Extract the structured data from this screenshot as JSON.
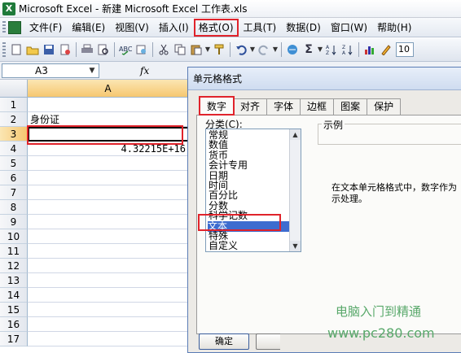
{
  "window": {
    "title": "Microsoft Excel - 新建 Microsoft Excel 工作表.xls"
  },
  "menubar": {
    "items": [
      {
        "label": "文件(F)"
      },
      {
        "label": "编辑(E)"
      },
      {
        "label": "视图(V)"
      },
      {
        "label": "插入(I)"
      },
      {
        "label": "格式(O)",
        "highlighted": true
      },
      {
        "label": "工具(T)"
      },
      {
        "label": "数据(D)"
      },
      {
        "label": "窗口(W)"
      },
      {
        "label": "帮助(H)"
      }
    ]
  },
  "toolbar": {
    "zoom_value": "10"
  },
  "formula_bar": {
    "name_box": "A3",
    "fx_label": "fx"
  },
  "sheet": {
    "column_header": "A",
    "rows": [
      {
        "num": "1",
        "value": ""
      },
      {
        "num": "2",
        "value": "身份证"
      },
      {
        "num": "3",
        "value": "",
        "selected": true
      },
      {
        "num": "4",
        "value": "4.32215E+16"
      },
      {
        "num": "5",
        "value": ""
      },
      {
        "num": "6",
        "value": ""
      },
      {
        "num": "7",
        "value": ""
      },
      {
        "num": "8",
        "value": ""
      },
      {
        "num": "9",
        "value": ""
      },
      {
        "num": "10",
        "value": ""
      },
      {
        "num": "11",
        "value": ""
      },
      {
        "num": "12",
        "value": ""
      },
      {
        "num": "13",
        "value": ""
      },
      {
        "num": "14",
        "value": ""
      },
      {
        "num": "15",
        "value": ""
      },
      {
        "num": "16",
        "value": ""
      },
      {
        "num": "17",
        "value": ""
      }
    ]
  },
  "dialog": {
    "title": "单元格格式",
    "tabs": [
      {
        "label": "数字",
        "active": true
      },
      {
        "label": "对齐"
      },
      {
        "label": "字体"
      },
      {
        "label": "边框"
      },
      {
        "label": "图案"
      },
      {
        "label": "保护"
      }
    ],
    "category_label": "分类(C):",
    "categories": [
      "常规",
      "数值",
      "货币",
      "会计专用",
      "日期",
      "时间",
      "百分比",
      "分数",
      "科学记数",
      "文本",
      "特殊",
      "自定义"
    ],
    "selected_category": "文本",
    "sample_label": "示例",
    "description_line1": "在文本单元格格式中，数字作为",
    "description_line2": "示处理。",
    "ok_label": "确定"
  },
  "watermark": {
    "line1": "电脑入门到精通",
    "line2": "www.pc280.com"
  },
  "colors": {
    "highlight_red": "#e0232b",
    "selection_blue": "#3d6ccf",
    "watermark_green": "#58a86a"
  }
}
